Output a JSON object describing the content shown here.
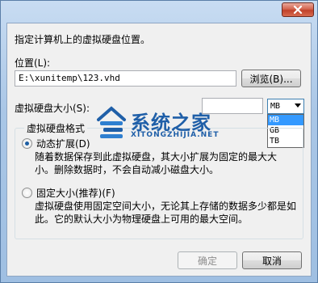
{
  "dialog": {
    "heading": "指定计算机上的虚拟硬盘位置。",
    "location_label": "位置(L):",
    "location_value": "E:\\xunitemp\\123.vhd",
    "browse_button": "浏览(B)...",
    "size_label": "虚拟硬盘大小(S):",
    "size_value": "",
    "unit_selected": "MB",
    "unit_options": [
      "MB",
      "GB",
      "TB"
    ],
    "format_group_title": "虚拟硬盘格式",
    "dynamic_option": {
      "label": "动态扩展(D)",
      "checked": true,
      "description_line1": "随着数据保存到此虚拟硬盘，其大小扩展为固定的最大大",
      "description_line2": "小。删除数据时，不会自动减小磁盘大小。"
    },
    "fixed_option": {
      "label": "固定大小(推荐)(F)",
      "checked": false,
      "description_line1": "虚拟硬盘使用固定空间大小，无论其上存储的数据多少都是如",
      "description_line2": "此。它的默认大小为物理硬盘上可用的最大空间。"
    },
    "ok_button": "确定",
    "cancel_button": "取消"
  },
  "watermark": {
    "title": "系统之家",
    "subtitle": "XITONGZHIJIA.NET"
  },
  "colors": {
    "accent": "#3399ff",
    "close_button": "#c0412a",
    "watermark": "#1f5fa8"
  }
}
